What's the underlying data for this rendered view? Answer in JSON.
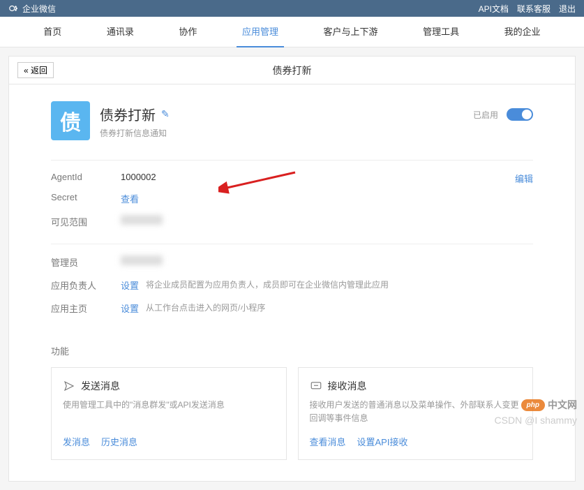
{
  "topbar": {
    "brand": "企业微信",
    "links": [
      "API文档",
      "联系客服",
      "退出"
    ]
  },
  "nav": {
    "items": [
      "首页",
      "通讯录",
      "协作",
      "应用管理",
      "客户与上下游",
      "管理工具",
      "我的企业"
    ],
    "active_index": 3
  },
  "page": {
    "back": "« 返回",
    "title": "债券打新"
  },
  "app": {
    "icon_char": "债",
    "name": "债券打新",
    "desc": "债券打新信息通知",
    "status_label": "已启用",
    "enabled": true
  },
  "info": {
    "rows": [
      {
        "label": "AgentId",
        "value": "1000002"
      },
      {
        "label": "Secret",
        "value_link": "查看"
      },
      {
        "label": "可见范围",
        "blurred": true
      }
    ],
    "edit": "编辑"
  },
  "admin": {
    "rows": [
      {
        "label": "管理员",
        "blurred": true
      },
      {
        "label": "应用负责人",
        "value_link": "设置",
        "desc": "将企业成员配置为应用负责人，成员即可在企业微信内管理此应用"
      },
      {
        "label": "应用主页",
        "value_link": "设置",
        "desc": "从工作台点击进入的网页/小程序"
      }
    ]
  },
  "functions": {
    "title": "功能",
    "cards": [
      {
        "icon": "send",
        "title": "发送消息",
        "desc": "使用管理工具中的\"消息群发\"或API发送消息",
        "links": [
          "发消息",
          "历史消息"
        ]
      },
      {
        "icon": "receive",
        "title": "接收消息",
        "desc": "接收用户发送的普通消息以及菜单操作、外部联系人变更回调等事件信息",
        "links": [
          "查看消息",
          "设置API接收"
        ]
      }
    ]
  },
  "watermarks": {
    "php_badge": "php",
    "php_text": "中文网",
    "csdn": "CSDN @I shammy"
  }
}
